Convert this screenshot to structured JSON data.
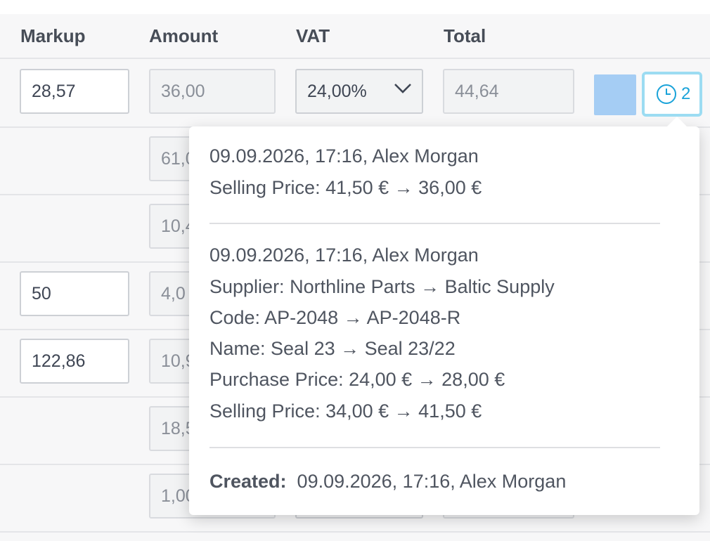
{
  "columns": {
    "markup": "Markup",
    "amount": "Amount",
    "vat": "VAT",
    "total": "Total"
  },
  "rows": [
    {
      "markup": "28,57",
      "amount": "36,00",
      "vat": "24,00%",
      "total": "44,64"
    },
    {
      "amount": "61,0"
    },
    {
      "amount": "10,4"
    },
    {
      "markup": "50",
      "amount": "4,0"
    },
    {
      "markup": "122,86",
      "amount": "10,9"
    },
    {
      "amount": "18,5"
    },
    {
      "amount": "1,00"
    }
  ],
  "color_swatch": "#a5cdf4",
  "history_button": {
    "count": "2",
    "icon": "clock-icon"
  },
  "popover": {
    "entry1": {
      "header": "09.09.2026, 17:16, Alex Morgan",
      "changes": [
        "Selling Price: 41,50 € → 36,00 €"
      ]
    },
    "entry2": {
      "header": "09.09.2026, 17:16, Alex Morgan",
      "changes": [
        "Supplier: Northline Parts → Baltic Supply",
        "Code: AP-2048 → AP-2048-R",
        "Name: Seal 23 → Seal 23/22",
        "Purchase Price: 24,00 € → 28,00 €",
        "Selling Price: 34,00 € → 41,50 €"
      ]
    },
    "created_label": "Created:",
    "created_value": "09.09.2026, 17:16, Alex Morgan"
  }
}
